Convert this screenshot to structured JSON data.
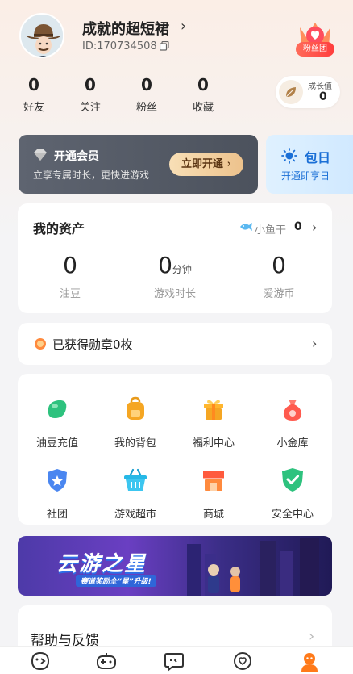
{
  "profile": {
    "username": "成就的超短裙",
    "id_text": "ID:170734508",
    "fan_badge_label": "粉丝团"
  },
  "stats": [
    {
      "value": "0",
      "label": "好友"
    },
    {
      "value": "0",
      "label": "关注"
    },
    {
      "value": "0",
      "label": "粉丝"
    },
    {
      "value": "0",
      "label": "收藏"
    }
  ],
  "growth": {
    "label": "成长值",
    "value": "0"
  },
  "vip": {
    "title": "开通会员",
    "subtitle": "立享专属时长，更快进游戏",
    "button": "立即开通 ›"
  },
  "pack": {
    "title": "包日",
    "subtitle": "开通即享日"
  },
  "assets": {
    "title": "我的资产",
    "fish_label": "小鱼干",
    "fish_value": "0",
    "items": [
      {
        "value": "0",
        "unit": "",
        "label": "油豆"
      },
      {
        "value": "0",
        "unit": "分钟",
        "label": "游戏时长"
      },
      {
        "value": "0",
        "unit": "",
        "label": "爱游币"
      }
    ]
  },
  "medal": {
    "text": "已获得勋章0枚"
  },
  "grid": [
    {
      "label": "油豆充值",
      "icon": "bean-icon",
      "color": "#2ec27e"
    },
    {
      "label": "我的背包",
      "icon": "backpack-icon",
      "color": "#f5a623"
    },
    {
      "label": "福利中心",
      "icon": "gift-icon",
      "color": "#f5a623"
    },
    {
      "label": "小金库",
      "icon": "moneybag-icon",
      "color": "#ff5a4e"
    },
    {
      "label": "社团",
      "icon": "shield-star-icon",
      "color": "#4a86f0"
    },
    {
      "label": "游戏超市",
      "icon": "basket-icon",
      "color": "#26b8e6"
    },
    {
      "label": "商城",
      "icon": "shop-icon",
      "color": "#ff7a3a"
    },
    {
      "label": "安全中心",
      "icon": "security-shield-icon",
      "color": "#2ec27e"
    }
  ],
  "banner": {
    "title": "云游之星",
    "subtitle": "赛道奖励全“星”升级!"
  },
  "help": {
    "title": "帮助与反馈"
  }
}
